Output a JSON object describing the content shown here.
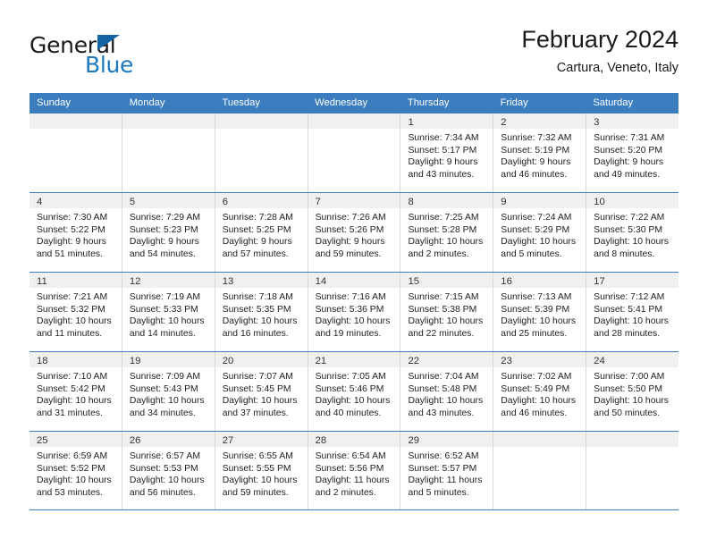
{
  "brand": {
    "name_top": "General",
    "name_bottom": "Blue",
    "accent_color": "#1c79c0",
    "triangle_color": "#1464a5"
  },
  "header": {
    "month_title": "February 2024",
    "location": "Cartura, Veneto, Italy"
  },
  "theme": {
    "header_bar_color": "#3b7dbe",
    "daynum_band_color": "#f0f0f0",
    "grid_line_color": "#d9d9d9",
    "text_color": "#222222"
  },
  "weekdays": [
    "Sunday",
    "Monday",
    "Tuesday",
    "Wednesday",
    "Thursday",
    "Friday",
    "Saturday"
  ],
  "labels": {
    "sunrise_prefix": "Sunrise:",
    "sunset_prefix": "Sunset:",
    "daylight_prefix": "Daylight:"
  },
  "weeks": [
    [
      {
        "day": "",
        "l1": "",
        "l2": "",
        "l3": "",
        "l4": ""
      },
      {
        "day": "",
        "l1": "",
        "l2": "",
        "l3": "",
        "l4": ""
      },
      {
        "day": "",
        "l1": "",
        "l2": "",
        "l3": "",
        "l4": ""
      },
      {
        "day": "",
        "l1": "",
        "l2": "",
        "l3": "",
        "l4": ""
      },
      {
        "day": "1",
        "l1": "Sunrise: 7:34 AM",
        "l2": "Sunset: 5:17 PM",
        "l3": "Daylight: 9 hours",
        "l4": "and 43 minutes."
      },
      {
        "day": "2",
        "l1": "Sunrise: 7:32 AM",
        "l2": "Sunset: 5:19 PM",
        "l3": "Daylight: 9 hours",
        "l4": "and 46 minutes."
      },
      {
        "day": "3",
        "l1": "Sunrise: 7:31 AM",
        "l2": "Sunset: 5:20 PM",
        "l3": "Daylight: 9 hours",
        "l4": "and 49 minutes."
      }
    ],
    [
      {
        "day": "4",
        "l1": "Sunrise: 7:30 AM",
        "l2": "Sunset: 5:22 PM",
        "l3": "Daylight: 9 hours",
        "l4": "and 51 minutes."
      },
      {
        "day": "5",
        "l1": "Sunrise: 7:29 AM",
        "l2": "Sunset: 5:23 PM",
        "l3": "Daylight: 9 hours",
        "l4": "and 54 minutes."
      },
      {
        "day": "6",
        "l1": "Sunrise: 7:28 AM",
        "l2": "Sunset: 5:25 PM",
        "l3": "Daylight: 9 hours",
        "l4": "and 57 minutes."
      },
      {
        "day": "7",
        "l1": "Sunrise: 7:26 AM",
        "l2": "Sunset: 5:26 PM",
        "l3": "Daylight: 9 hours",
        "l4": "and 59 minutes."
      },
      {
        "day": "8",
        "l1": "Sunrise: 7:25 AM",
        "l2": "Sunset: 5:28 PM",
        "l3": "Daylight: 10 hours",
        "l4": "and 2 minutes."
      },
      {
        "day": "9",
        "l1": "Sunrise: 7:24 AM",
        "l2": "Sunset: 5:29 PM",
        "l3": "Daylight: 10 hours",
        "l4": "and 5 minutes."
      },
      {
        "day": "10",
        "l1": "Sunrise: 7:22 AM",
        "l2": "Sunset: 5:30 PM",
        "l3": "Daylight: 10 hours",
        "l4": "and 8 minutes."
      }
    ],
    [
      {
        "day": "11",
        "l1": "Sunrise: 7:21 AM",
        "l2": "Sunset: 5:32 PM",
        "l3": "Daylight: 10 hours",
        "l4": "and 11 minutes."
      },
      {
        "day": "12",
        "l1": "Sunrise: 7:19 AM",
        "l2": "Sunset: 5:33 PM",
        "l3": "Daylight: 10 hours",
        "l4": "and 14 minutes."
      },
      {
        "day": "13",
        "l1": "Sunrise: 7:18 AM",
        "l2": "Sunset: 5:35 PM",
        "l3": "Daylight: 10 hours",
        "l4": "and 16 minutes."
      },
      {
        "day": "14",
        "l1": "Sunrise: 7:16 AM",
        "l2": "Sunset: 5:36 PM",
        "l3": "Daylight: 10 hours",
        "l4": "and 19 minutes."
      },
      {
        "day": "15",
        "l1": "Sunrise: 7:15 AM",
        "l2": "Sunset: 5:38 PM",
        "l3": "Daylight: 10 hours",
        "l4": "and 22 minutes."
      },
      {
        "day": "16",
        "l1": "Sunrise: 7:13 AM",
        "l2": "Sunset: 5:39 PM",
        "l3": "Daylight: 10 hours",
        "l4": "and 25 minutes."
      },
      {
        "day": "17",
        "l1": "Sunrise: 7:12 AM",
        "l2": "Sunset: 5:41 PM",
        "l3": "Daylight: 10 hours",
        "l4": "and 28 minutes."
      }
    ],
    [
      {
        "day": "18",
        "l1": "Sunrise: 7:10 AM",
        "l2": "Sunset: 5:42 PM",
        "l3": "Daylight: 10 hours",
        "l4": "and 31 minutes."
      },
      {
        "day": "19",
        "l1": "Sunrise: 7:09 AM",
        "l2": "Sunset: 5:43 PM",
        "l3": "Daylight: 10 hours",
        "l4": "and 34 minutes."
      },
      {
        "day": "20",
        "l1": "Sunrise: 7:07 AM",
        "l2": "Sunset: 5:45 PM",
        "l3": "Daylight: 10 hours",
        "l4": "and 37 minutes."
      },
      {
        "day": "21",
        "l1": "Sunrise: 7:05 AM",
        "l2": "Sunset: 5:46 PM",
        "l3": "Daylight: 10 hours",
        "l4": "and 40 minutes."
      },
      {
        "day": "22",
        "l1": "Sunrise: 7:04 AM",
        "l2": "Sunset: 5:48 PM",
        "l3": "Daylight: 10 hours",
        "l4": "and 43 minutes."
      },
      {
        "day": "23",
        "l1": "Sunrise: 7:02 AM",
        "l2": "Sunset: 5:49 PM",
        "l3": "Daylight: 10 hours",
        "l4": "and 46 minutes."
      },
      {
        "day": "24",
        "l1": "Sunrise: 7:00 AM",
        "l2": "Sunset: 5:50 PM",
        "l3": "Daylight: 10 hours",
        "l4": "and 50 minutes."
      }
    ],
    [
      {
        "day": "25",
        "l1": "Sunrise: 6:59 AM",
        "l2": "Sunset: 5:52 PM",
        "l3": "Daylight: 10 hours",
        "l4": "and 53 minutes."
      },
      {
        "day": "26",
        "l1": "Sunrise: 6:57 AM",
        "l2": "Sunset: 5:53 PM",
        "l3": "Daylight: 10 hours",
        "l4": "and 56 minutes."
      },
      {
        "day": "27",
        "l1": "Sunrise: 6:55 AM",
        "l2": "Sunset: 5:55 PM",
        "l3": "Daylight: 10 hours",
        "l4": "and 59 minutes."
      },
      {
        "day": "28",
        "l1": "Sunrise: 6:54 AM",
        "l2": "Sunset: 5:56 PM",
        "l3": "Daylight: 11 hours",
        "l4": "and 2 minutes."
      },
      {
        "day": "29",
        "l1": "Sunrise: 6:52 AM",
        "l2": "Sunset: 5:57 PM",
        "l3": "Daylight: 11 hours",
        "l4": "and 5 minutes."
      },
      {
        "day": "",
        "l1": "",
        "l2": "",
        "l3": "",
        "l4": ""
      },
      {
        "day": "",
        "l1": "",
        "l2": "",
        "l3": "",
        "l4": ""
      }
    ]
  ]
}
